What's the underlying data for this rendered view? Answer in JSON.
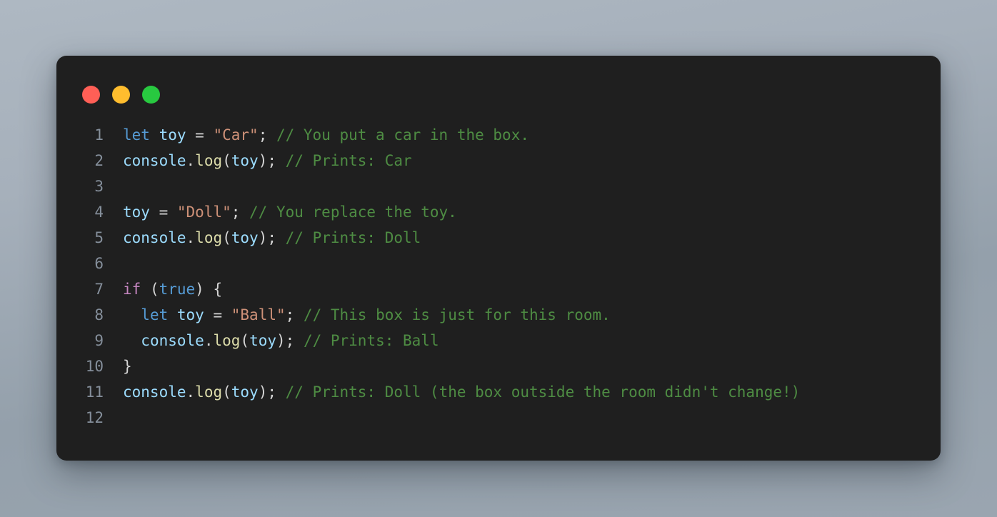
{
  "window": {
    "controls": [
      {
        "name": "close",
        "color": "#ff5f56"
      },
      {
        "name": "minimize",
        "color": "#ffbd2e"
      },
      {
        "name": "maximize",
        "color": "#28c940"
      }
    ]
  },
  "editor": {
    "language": "javascript",
    "line_numbers": [
      "1",
      "2",
      "3",
      "4",
      "5",
      "6",
      "7",
      "8",
      "9",
      "10",
      "11",
      "12"
    ],
    "lines": [
      {
        "number": "1",
        "text": "let toy = \"Car\"; // You put a car in the box.",
        "tokens": [
          {
            "t": "let",
            "c": "tok-kw"
          },
          {
            "t": " ",
            "c": "tok-punct"
          },
          {
            "t": "toy",
            "c": "tok-var"
          },
          {
            "t": " = ",
            "c": "tok-punct"
          },
          {
            "t": "\"Car\"",
            "c": "tok-str"
          },
          {
            "t": "; ",
            "c": "tok-punct"
          },
          {
            "t": "// You put a car in the box.",
            "c": "tok-comment"
          }
        ]
      },
      {
        "number": "2",
        "text": "console.log(toy); // Prints: Car",
        "tokens": [
          {
            "t": "console",
            "c": "tok-var"
          },
          {
            "t": ".",
            "c": "tok-punct"
          },
          {
            "t": "log",
            "c": "tok-fn"
          },
          {
            "t": "(",
            "c": "tok-punct"
          },
          {
            "t": "toy",
            "c": "tok-var"
          },
          {
            "t": "); ",
            "c": "tok-punct"
          },
          {
            "t": "// Prints: Car",
            "c": "tok-comment"
          }
        ]
      },
      {
        "number": "3",
        "text": "",
        "tokens": []
      },
      {
        "number": "4",
        "text": "toy = \"Doll\"; // You replace the toy.",
        "tokens": [
          {
            "t": "toy",
            "c": "tok-var"
          },
          {
            "t": " = ",
            "c": "tok-punct"
          },
          {
            "t": "\"Doll\"",
            "c": "tok-str"
          },
          {
            "t": "; ",
            "c": "tok-punct"
          },
          {
            "t": "// You replace the toy.",
            "c": "tok-comment"
          }
        ]
      },
      {
        "number": "5",
        "text": "console.log(toy); // Prints: Doll",
        "tokens": [
          {
            "t": "console",
            "c": "tok-var"
          },
          {
            "t": ".",
            "c": "tok-punct"
          },
          {
            "t": "log",
            "c": "tok-fn"
          },
          {
            "t": "(",
            "c": "tok-punct"
          },
          {
            "t": "toy",
            "c": "tok-var"
          },
          {
            "t": "); ",
            "c": "tok-punct"
          },
          {
            "t": "// Prints: Doll",
            "c": "tok-comment"
          }
        ]
      },
      {
        "number": "6",
        "text": "",
        "tokens": []
      },
      {
        "number": "7",
        "text": "if (true) {",
        "tokens": [
          {
            "t": "if",
            "c": "tok-kwctrl"
          },
          {
            "t": " (",
            "c": "tok-punct"
          },
          {
            "t": "true",
            "c": "tok-bool"
          },
          {
            "t": ") {",
            "c": "tok-punct"
          }
        ]
      },
      {
        "number": "8",
        "text": "  let toy = \"Ball\"; // This box is just for this room.",
        "tokens": [
          {
            "t": "  ",
            "c": "tok-punct"
          },
          {
            "t": "let",
            "c": "tok-kw"
          },
          {
            "t": " ",
            "c": "tok-punct"
          },
          {
            "t": "toy",
            "c": "tok-var"
          },
          {
            "t": " = ",
            "c": "tok-punct"
          },
          {
            "t": "\"Ball\"",
            "c": "tok-str"
          },
          {
            "t": "; ",
            "c": "tok-punct"
          },
          {
            "t": "// This box is just for this room.",
            "c": "tok-comment"
          }
        ]
      },
      {
        "number": "9",
        "text": "  console.log(toy); // Prints: Ball",
        "tokens": [
          {
            "t": "  ",
            "c": "tok-punct"
          },
          {
            "t": "console",
            "c": "tok-var"
          },
          {
            "t": ".",
            "c": "tok-punct"
          },
          {
            "t": "log",
            "c": "tok-fn"
          },
          {
            "t": "(",
            "c": "tok-punct"
          },
          {
            "t": "toy",
            "c": "tok-var"
          },
          {
            "t": "); ",
            "c": "tok-punct"
          },
          {
            "t": "// Prints: Ball",
            "c": "tok-comment"
          }
        ]
      },
      {
        "number": "10",
        "text": "}",
        "tokens": [
          {
            "t": "}",
            "c": "tok-punct"
          }
        ]
      },
      {
        "number": "11",
        "text": "console.log(toy); // Prints: Doll (the box outside the room didn't change!)",
        "tokens": [
          {
            "t": "console",
            "c": "tok-var"
          },
          {
            "t": ".",
            "c": "tok-punct"
          },
          {
            "t": "log",
            "c": "tok-fn"
          },
          {
            "t": "(",
            "c": "tok-punct"
          },
          {
            "t": "toy",
            "c": "tok-var"
          },
          {
            "t": "); ",
            "c": "tok-punct"
          },
          {
            "t": "// Prints: Doll (the box outside the room didn't change!)",
            "c": "tok-comment"
          }
        ]
      },
      {
        "number": "12",
        "text": "",
        "tokens": []
      }
    ]
  },
  "colors": {
    "card_background": "#1f1f1f",
    "page_background": "#a6b0bb",
    "keyword": "#569cd6",
    "variable": "#9cdcfe",
    "function": "#dcdcaa",
    "string": "#ce9178",
    "comment": "#4e8c43",
    "control_keyword": "#c586c0",
    "punctuation": "#d4d4d4",
    "line_number": "#858f9b"
  }
}
